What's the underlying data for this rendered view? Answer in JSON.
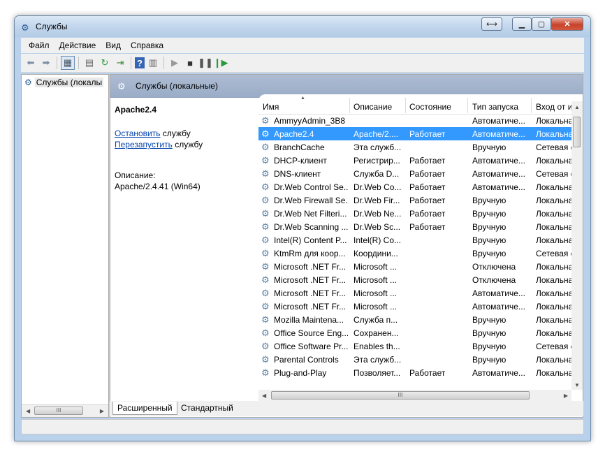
{
  "window": {
    "title": "Службы"
  },
  "menu": [
    "Файл",
    "Действие",
    "Вид",
    "Справка"
  ],
  "tree": {
    "item": "Службы (локалы"
  },
  "main": {
    "header": "Службы (локальные)"
  },
  "details": {
    "service_name": "Apache2.4",
    "stop_link": "Остановить",
    "stop_suffix": "службу",
    "restart_link": "Перезапустить",
    "restart_suffix": "службу",
    "desc_label": "Описание:",
    "desc_text": "Apache/2.4.41 (Win64)"
  },
  "table": {
    "columns": [
      "Имя",
      "Описание",
      "Состояние",
      "Тип запуска",
      "Вход от и"
    ],
    "rows": [
      {
        "name": "AmmyyAdmin_3B8",
        "desc": "",
        "state": "",
        "startup": "Автоматиче...",
        "logon": "Локальна"
      },
      {
        "name": "Apache2.4",
        "desc": "Apache/2....",
        "state": "Работает",
        "startup": "Автоматиче...",
        "logon": "Локальна"
      },
      {
        "name": "BranchCache",
        "desc": "Эта служб...",
        "state": "",
        "startup": "Вручную",
        "logon": "Сетевая с"
      },
      {
        "name": "DHCP-клиент",
        "desc": "Регистрир...",
        "state": "Работает",
        "startup": "Автоматиче...",
        "logon": "Локальна"
      },
      {
        "name": "DNS-клиент",
        "desc": "Служба D...",
        "state": "Работает",
        "startup": "Автоматиче...",
        "logon": "Сетевая с"
      },
      {
        "name": "Dr.Web Control Se...",
        "desc": "Dr.Web Co...",
        "state": "Работает",
        "startup": "Автоматиче...",
        "logon": "Локальна"
      },
      {
        "name": "Dr.Web Firewall Se...",
        "desc": "Dr.Web Fir...",
        "state": "Работает",
        "startup": "Вручную",
        "logon": "Локальна"
      },
      {
        "name": "Dr.Web Net Filteri...",
        "desc": "Dr.Web Ne...",
        "state": "Работает",
        "startup": "Вручную",
        "logon": "Локальна"
      },
      {
        "name": "Dr.Web Scanning ...",
        "desc": "Dr.Web Sc...",
        "state": "Работает",
        "startup": "Вручную",
        "logon": "Локальна"
      },
      {
        "name": "Intel(R) Content P...",
        "desc": "Intel(R) Co...",
        "state": "",
        "startup": "Вручную",
        "logon": "Локальна"
      },
      {
        "name": "KtmRm для коор...",
        "desc": "Координи...",
        "state": "",
        "startup": "Вручную",
        "logon": "Сетевая с"
      },
      {
        "name": "Microsoft .NET Fr...",
        "desc": "Microsoft ...",
        "state": "",
        "startup": "Отключена",
        "logon": "Локальна"
      },
      {
        "name": "Microsoft .NET Fr...",
        "desc": "Microsoft ...",
        "state": "",
        "startup": "Отключена",
        "logon": "Локальна"
      },
      {
        "name": "Microsoft .NET Fr...",
        "desc": "Microsoft ...",
        "state": "",
        "startup": "Автоматиче...",
        "logon": "Локальна"
      },
      {
        "name": "Microsoft .NET Fr...",
        "desc": "Microsoft ...",
        "state": "",
        "startup": "Автоматиче...",
        "logon": "Локальна"
      },
      {
        "name": "Mozilla Maintena...",
        "desc": "Служба п...",
        "state": "",
        "startup": "Вручную",
        "logon": "Локальна"
      },
      {
        "name": "Office  Source Eng...",
        "desc": "Сохранен...",
        "state": "",
        "startup": "Вручную",
        "logon": "Локальна"
      },
      {
        "name": "Office Software Pr...",
        "desc": "Enables th...",
        "state": "",
        "startup": "Вручную",
        "logon": "Сетевая с"
      },
      {
        "name": "Parental Controls",
        "desc": "Эта служб...",
        "state": "",
        "startup": "Вручную",
        "logon": "Локальна"
      },
      {
        "name": "Plug-and-Play",
        "desc": "Позволяет...",
        "state": "Работает",
        "startup": "Автоматиче...",
        "logon": "Локальна"
      }
    ],
    "selected_index": 1,
    "hscroll_grip": "III"
  },
  "tabs": [
    "Расширенный",
    "Стандартный"
  ],
  "left_scroll_grip": "III",
  "colors": {
    "selection": "#3399ff",
    "link": "#0645ad",
    "header": "#9aacc7"
  }
}
